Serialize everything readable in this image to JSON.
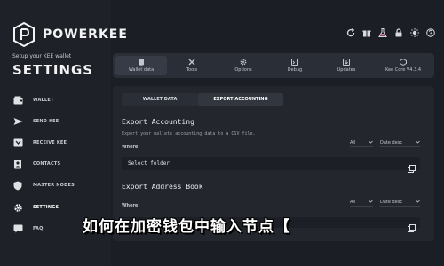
{
  "brand": {
    "name": "POWERKEE",
    "subtitle": "Setup your KEE wallet",
    "title": "SETTINGS"
  },
  "sidebar": {
    "items": [
      {
        "label": "WALLET",
        "icon": "wallet-icon"
      },
      {
        "label": "SEND KEE",
        "icon": "send-icon"
      },
      {
        "label": "RECEIVE KEE",
        "icon": "receive-icon"
      },
      {
        "label": "CONTACTS",
        "icon": "contacts-icon"
      },
      {
        "label": "MASTER NODES",
        "icon": "shield-icon"
      },
      {
        "label": "SETTINGS",
        "icon": "gear-icon"
      },
      {
        "label": "FAQ",
        "icon": "faq-icon"
      }
    ]
  },
  "topbar": {
    "icons": [
      "refresh-icon",
      "gift-icon",
      "flask-icon",
      "lock-icon",
      "sun-icon",
      "help-icon"
    ]
  },
  "tabs": [
    {
      "label": "Wallet data",
      "icon": "database-icon"
    },
    {
      "label": "Tools",
      "icon": "tools-icon"
    },
    {
      "label": "Options",
      "icon": "options-icon"
    },
    {
      "label": "Debug",
      "icon": "debug-icon"
    },
    {
      "label": "Updates",
      "icon": "updates-icon"
    },
    {
      "label": "Kee Core V4.3.4",
      "icon": "core-icon"
    }
  ],
  "subtabs": [
    "WALLET DATA",
    "EXPORT ACCOUNTING"
  ],
  "export_accounting": {
    "title": "Export Accounting",
    "description": "Export your wallets accounting data to a CSV file.",
    "where_label": "Where",
    "filter_value": "All",
    "sort_value": "Date desc",
    "folder_placeholder": "Select folder"
  },
  "export_address_book": {
    "title": "Export Address Book",
    "where_label": "Where",
    "filter_value": "All",
    "sort_value": "Date desc"
  },
  "caption": "如何在加密钱包中输入节点【",
  "colors": {
    "background": "#1b1e24",
    "panel": "#23262d",
    "accent": "#ffffff"
  }
}
